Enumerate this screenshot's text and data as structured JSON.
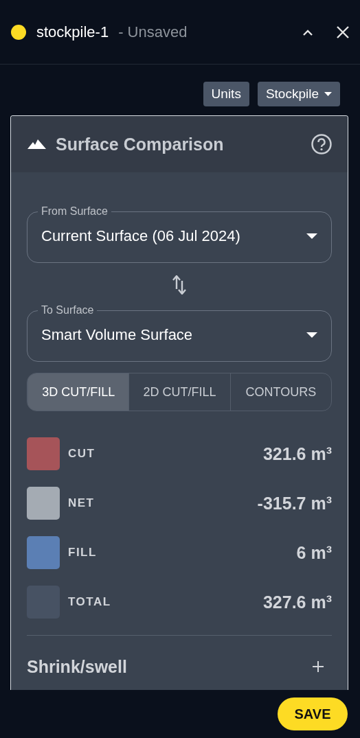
{
  "window": {
    "title": "stockpile-1",
    "status": "- Unsaved"
  },
  "toolbar": {
    "buttons": [
      {
        "label": "Units",
        "kind": "button"
      },
      {
        "label": "Stockpile",
        "kind": "dropdown"
      }
    ]
  },
  "panel": {
    "title": "Surface Comparison",
    "from_surface": {
      "label": "From Surface",
      "value": "Current Surface (06 Jul 2024)"
    },
    "to_surface": {
      "label": "To Surface",
      "value": "Smart Volume Surface"
    },
    "tabs": [
      {
        "label": "3D CUT/FILL",
        "selected": true
      },
      {
        "label": "2D CUT/FILL",
        "selected": false
      },
      {
        "label": "CONTOURS",
        "selected": false
      }
    ],
    "legend": [
      {
        "label": "CUT",
        "value": "321.6 m³",
        "color": "#a65459"
      },
      {
        "label": "NET",
        "value": "-315.7 m³",
        "color": "#a4abb3"
      },
      {
        "label": "FILL",
        "value": "6 m³",
        "color": "#5b7fb4"
      },
      {
        "label": "TOTAL",
        "value": "327.6 m³",
        "color": "#475263"
      }
    ],
    "section": {
      "title": "Shrink/swell",
      "expanded": false
    }
  },
  "footer": {
    "save_button": "SAVE"
  }
}
